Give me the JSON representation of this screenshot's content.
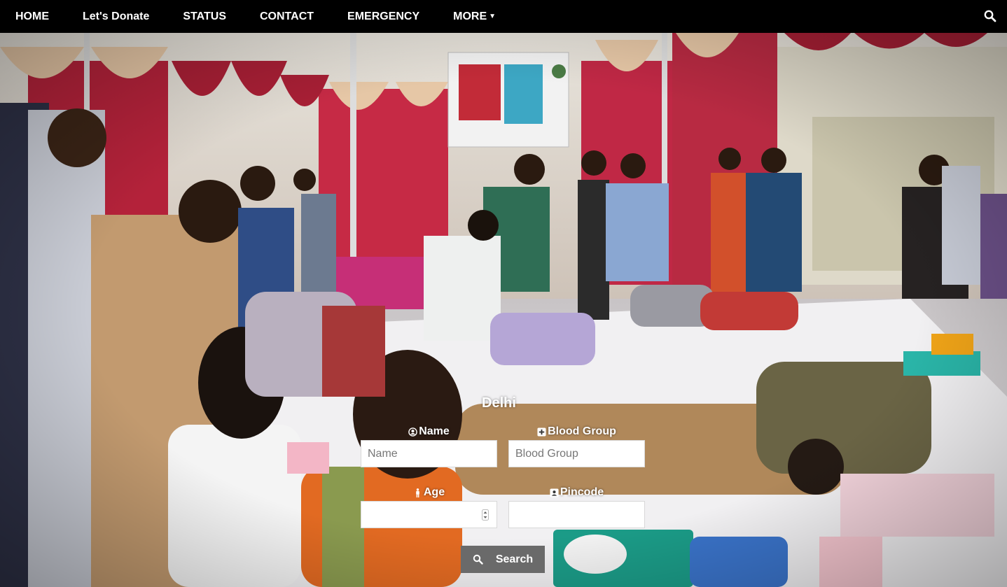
{
  "nav": {
    "items": [
      {
        "label": "HOME"
      },
      {
        "label": "Let's Donate"
      },
      {
        "label": "STATUS"
      },
      {
        "label": "CONTACT"
      },
      {
        "label": "EMERGENCY"
      },
      {
        "label": "MORE"
      }
    ],
    "more_icon": "caret-down-icon",
    "search_icon": "search-icon"
  },
  "search_form": {
    "city": "Delhi",
    "name": {
      "label": "Name",
      "icon": "user-circle-icon",
      "placeholder": "Name",
      "value": ""
    },
    "blood_group": {
      "label": "Blood Group",
      "icon": "plus-square-icon",
      "placeholder": "Blood Group",
      "value": ""
    },
    "age": {
      "label": "Age",
      "icon": "male-icon",
      "value": ""
    },
    "pincode": {
      "label": "Pincode",
      "icon": "contact-card-icon",
      "value": ""
    },
    "submit_label": "Search",
    "submit_icon": "search-icon"
  },
  "colors": {
    "navbar_bg": "#000000",
    "button_bg": "#6a6a6a",
    "text": "#ffffff"
  }
}
